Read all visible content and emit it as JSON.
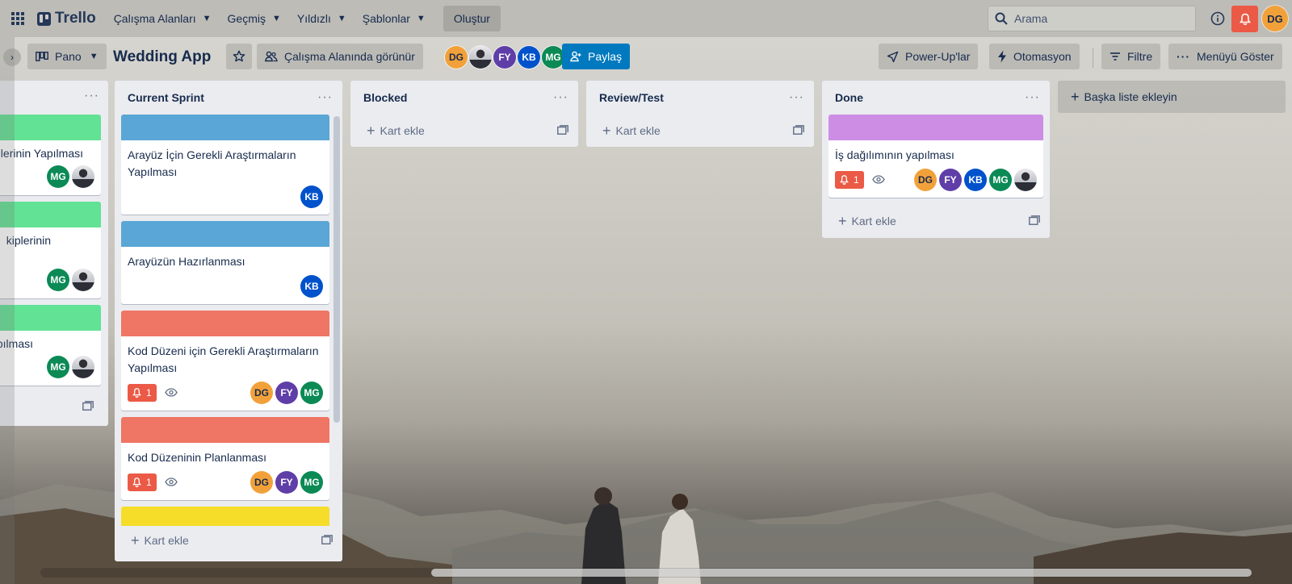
{
  "topbar": {
    "brand": "Trello",
    "menus": [
      "Çalışma Alanları",
      "Geçmiş",
      "Yıldızlı",
      "Şablonlar"
    ],
    "create_label": "Oluştur",
    "search_placeholder": "Arama",
    "user_initials": "DG"
  },
  "board": {
    "view_label": "Pano",
    "title": "Wedding App",
    "visibility_label": "Çalışma Alanında görünür",
    "members": [
      "DG",
      "photo",
      "FY",
      "KB",
      "MG"
    ],
    "share_label": "Paylaş",
    "powerups_label": "Power-Up'lar",
    "automation_label": "Otomasyon",
    "filter_label": "Filtre",
    "menu_label": "Menüyü Göster",
    "add_list_label": "Başka liste ekleyin"
  },
  "left_list": {
    "cards": [
      {
        "title_fragment": "lerinin Yapılması",
        "members": [
          "MG",
          "photo"
        ]
      },
      {
        "title_fragment": "kiplerinin",
        "members": [
          "MG",
          "photo"
        ]
      },
      {
        "title_fragment": "pılması",
        "members": [
          "MG",
          "photo"
        ]
      }
    ]
  },
  "lists": [
    {
      "title": "Current Sprint",
      "add_card_label": "Kart ekle",
      "cards": [
        {
          "cover": "#5aa6d6",
          "title": "Arayüz İçin Gerekli Araştırmaların Yapılması",
          "notifications": null,
          "watched": false,
          "members": [
            "KB"
          ]
        },
        {
          "cover": "#5aa6d6",
          "title": "Arayüzün Hazırlanması",
          "notifications": null,
          "watched": false,
          "members": [
            "KB"
          ]
        },
        {
          "cover": "#ef7564",
          "title": "Kod Düzeni için Gerekli Araştırmaların Yapılması",
          "notifications": "1",
          "watched": true,
          "members": [
            "DG",
            "FY",
            "MG"
          ]
        },
        {
          "cover": "#ef7564",
          "title": "Kod Düzeninin Planlanması",
          "notifications": "1",
          "watched": true,
          "members": [
            "DG",
            "FY",
            "MG"
          ]
        },
        {
          "cover": "#f5dd29",
          "title": "",
          "notifications": null,
          "watched": false,
          "members": []
        }
      ]
    },
    {
      "title": "Blocked",
      "add_card_label": "Kart ekle",
      "cards": []
    },
    {
      "title": "Review/Test",
      "add_card_label": "Kart ekle",
      "cards": []
    },
    {
      "title": "Done",
      "add_card_label": "Kart ekle",
      "cards": [
        {
          "cover": "#cd8de5",
          "title": "İş dağılımının yapılması",
          "notifications": "1",
          "watched": true,
          "members": [
            "DG",
            "FY",
            "KB",
            "MG",
            "photo"
          ]
        }
      ]
    }
  ],
  "avatar_colors": {
    "DG": "#f2a13a",
    "FY": "#5f3ea8",
    "KB": "#0052cc",
    "MG": "#0b8a55"
  }
}
